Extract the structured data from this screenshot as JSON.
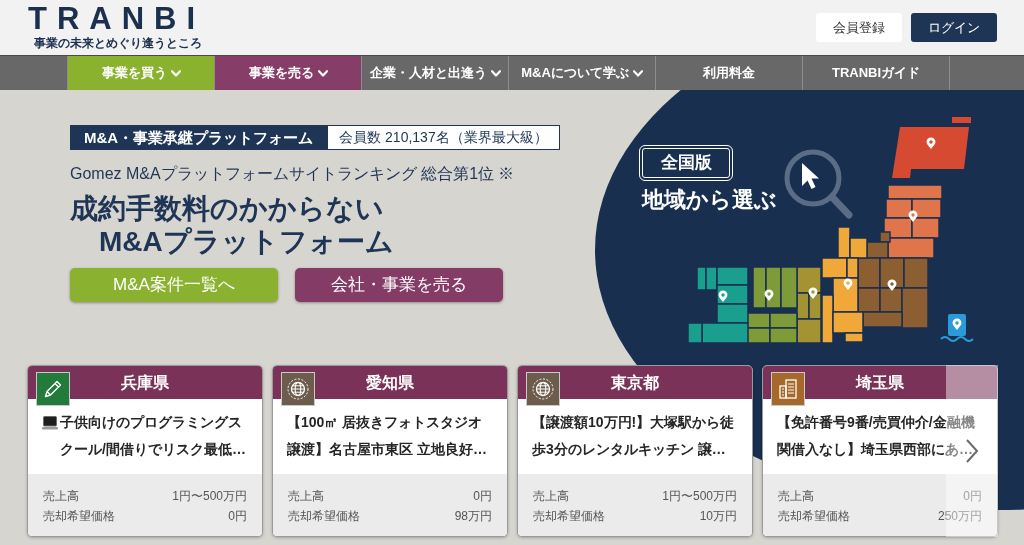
{
  "header": {
    "logo": "TRANBI",
    "tagline": "事業の未来とめぐり逢うところ",
    "buttons": [
      {
        "label": "会員登録",
        "kind": "secondary"
      },
      {
        "label": "ログイン",
        "kind": "primary"
      }
    ]
  },
  "nav": [
    {
      "label": "事業を買う",
      "dropdown": true,
      "color": "#8bb22e"
    },
    {
      "label": "事業を売る",
      "dropdown": true,
      "color": "#863d68"
    },
    {
      "label": "企業・人材と出逢う",
      "dropdown": true
    },
    {
      "label": "M&Aについて学ぶ",
      "dropdown": true
    },
    {
      "label": "利用料金",
      "dropdown": false
    },
    {
      "label": "TRANBIガイド",
      "dropdown": false
    }
  ],
  "hero": {
    "platform_badge": "M&A・事業承継プラットフォーム",
    "member_count": "会員数 210,137名（業界最大級）",
    "ranking": "Gomez M&Aプラットフォームサイトランキング 総合第1位 ※",
    "headline": [
      "成約手数料のかからない",
      "M&Aプラットフォーム"
    ],
    "buttons": [
      {
        "label": "M&A案件一覧へ",
        "color": "#8ab12f"
      },
      {
        "label": "会社・事業を売る",
        "color": "#843c66"
      }
    ]
  },
  "region_search": {
    "badge": "全国版",
    "title": "地域から選ぶ"
  },
  "listings": [
    {
      "prefecture": "兵庫県",
      "kind": "pencil",
      "title_icon": true,
      "title": "子供向けのプログラミングスクール/間借りでリスク最低…",
      "rows": [
        {
          "label": "売上高",
          "value": "1円〜500万円"
        },
        {
          "label": "売却希望価格",
          "value": "0円"
        }
      ]
    },
    {
      "prefecture": "愛知県",
      "kind": "globe",
      "title_icon": false,
      "title": "【100㎡ 居抜きフォトスタジオ譲渡】名古屋市東区 立地良好…",
      "rows": [
        {
          "label": "売上高",
          "value": "0円"
        },
        {
          "label": "売却希望価格",
          "value": "98万円"
        }
      ]
    },
    {
      "prefecture": "東京都",
      "kind": "globe",
      "title_icon": false,
      "title": "【譲渡額10万円!】大塚駅から徒歩3分のレンタルキッチン 譲…",
      "rows": [
        {
          "label": "売上高",
          "value": "1円〜500万円"
        },
        {
          "label": "売却希望価格",
          "value": "10万円"
        }
      ]
    },
    {
      "prefecture": "埼玉県",
      "kind": "building",
      "title_icon": false,
      "title": "【免許番号9番/売買仲介/金融機関借入なし】埼玉県西部にあ…",
      "rows": [
        {
          "label": "売上高",
          "value": "0円"
        },
        {
          "label": "売却希望価格",
          "value": "250万円"
        }
      ]
    }
  ]
}
